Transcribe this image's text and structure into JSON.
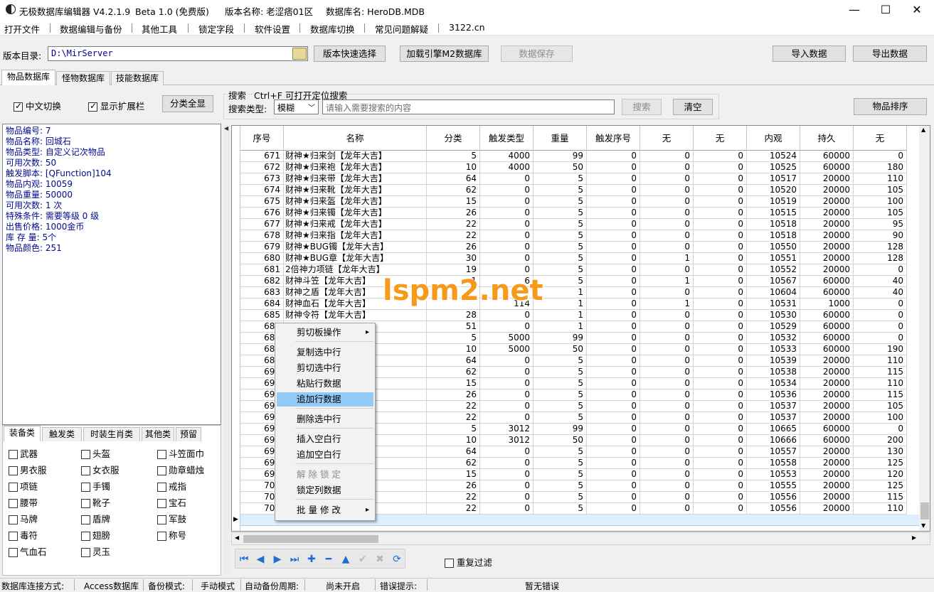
{
  "title": {
    "app": "无极数据库编辑器 V4.2.1.9",
    "beta": "Beta 1.0 (免费版)",
    "version_name": "版本名称: 老涩痞01区",
    "db_name": "数据库名: HeroDB.MDB"
  },
  "window_controls": {
    "minimize": "—",
    "maximize": "☐",
    "close": "✕"
  },
  "menu": [
    "打开文件",
    "数据编辑与备份",
    "其他工具",
    "锁定字段",
    "软件设置",
    "数据库切换",
    "常见问题解疑",
    "3122.cn"
  ],
  "toolbar": {
    "dir_label": "版本目录:",
    "dir_value": "D:\\MirServer",
    "quick_select": "版本快速选择",
    "load_engine": "加载引擎M2数据库",
    "save_data": "数据保存",
    "import": "导入数据",
    "export": "导出数据"
  },
  "tabs": [
    "物品数据库",
    "怪物数据库",
    "技能数据库"
  ],
  "options": {
    "chinese": "中文切换",
    "show_ext": "显示扩展栏",
    "show_all": "分类全显",
    "search_title": "搜索",
    "search_hint": "Ctrl+F 可打开定位搜索",
    "search_type_label": "搜索类型:",
    "search_type_value": "模糊",
    "search_placeholder": "请输入需要搜索的内容",
    "search_btn": "搜索",
    "clear_btn": "清空",
    "sort_btn": "物品排序"
  },
  "info_lines": [
    "物品编号: 7",
    "物品名称: 回城石",
    "物品类型: 自定义记次物品",
    "可用次数: 50",
    "触发脚本: [QFunction]104",
    "物品内观: 10059",
    "物品重量: 50000",
    "可用次数: 1 次",
    "特殊条件: 需要等级 0 级",
    "出售价格: 1000金币",
    "库 存 量: 5个",
    "物品颜色: 251"
  ],
  "cat_tabs": [
    "装备类",
    "触发类",
    "时装生肖类",
    "其他类",
    "预留"
  ],
  "categories": [
    [
      "武器",
      "头盔",
      "斗笠面巾"
    ],
    [
      "男衣服",
      "女衣服",
      "勋章蜡烛"
    ],
    [
      "项链",
      "手镯",
      "戒指"
    ],
    [
      "腰带",
      "靴子",
      "宝石"
    ],
    [
      "马牌",
      "盾牌",
      "军鼓"
    ],
    [
      "毒符",
      "翅膀",
      "称号"
    ],
    [
      "气血石",
      "灵玉",
      ""
    ]
  ],
  "columns": [
    "序号",
    "名称",
    "分类",
    "触发类型",
    "重量",
    "触发序号",
    "无",
    "无",
    "内观",
    "持久",
    "无"
  ],
  "rows": [
    [
      "671",
      "财神★归来剑【龙年大吉】",
      "5",
      "4000",
      "99",
      "0",
      "0",
      "0",
      "10524",
      "60000",
      "0"
    ],
    [
      "672",
      "财神★归来袍【龙年大吉】",
      "10",
      "4000",
      "50",
      "0",
      "0",
      "0",
      "10525",
      "60000",
      "180"
    ],
    [
      "673",
      "财神★归来带【龙年大吉】",
      "64",
      "0",
      "5",
      "0",
      "0",
      "0",
      "10517",
      "20000",
      "110"
    ],
    [
      "674",
      "财神★归来靴【龙年大吉】",
      "62",
      "0",
      "5",
      "0",
      "0",
      "0",
      "10520",
      "20000",
      "105"
    ],
    [
      "675",
      "财神★归来盔【龙年大吉】",
      "15",
      "0",
      "5",
      "0",
      "0",
      "0",
      "10519",
      "20000",
      "100"
    ],
    [
      "676",
      "财神★归来镯【龙年大吉】",
      "26",
      "0",
      "5",
      "0",
      "0",
      "0",
      "10515",
      "20000",
      "105"
    ],
    [
      "677",
      "财神★归来戒【龙年大吉】",
      "22",
      "0",
      "5",
      "0",
      "0",
      "0",
      "10518",
      "20000",
      "95"
    ],
    [
      "678",
      "财神★归来指【龙年大吉】",
      "22",
      "0",
      "5",
      "0",
      "0",
      "0",
      "10518",
      "20000",
      "90"
    ],
    [
      "679",
      "财神★BUG镯【龙年大吉】",
      "26",
      "0",
      "5",
      "0",
      "0",
      "0",
      "10550",
      "20000",
      "128"
    ],
    [
      "680",
      "财神★BUG章【龙年大吉】",
      "30",
      "0",
      "5",
      "0",
      "1",
      "0",
      "10551",
      "20000",
      "128"
    ],
    [
      "681",
      "2倍神力项链【龙年大吉】",
      "19",
      "0",
      "5",
      "0",
      "0",
      "0",
      "10552",
      "20000",
      "0"
    ],
    [
      "682",
      "财神斗笠【龙年大吉】",
      "1",
      "6",
      "5",
      "0",
      "1",
      "0",
      "10567",
      "60000",
      "40"
    ],
    [
      "683",
      "财神之盾【龙年大吉】",
      "",
      "",
      "1",
      "0",
      "0",
      "0",
      "10604",
      "60000",
      "40"
    ],
    [
      "684",
      "财神血石【龙年大吉】",
      "",
      "114",
      "1",
      "0",
      "1",
      "0",
      "10531",
      "1000",
      "0"
    ],
    [
      "685",
      "财神令符【龙年大吉】",
      "28",
      "0",
      "1",
      "0",
      "0",
      "0",
      "10530",
      "60000",
      "0"
    ],
    [
      "686",
      "",
      "51",
      "0",
      "1",
      "0",
      "0",
      "0",
      "10529",
      "60000",
      "0"
    ],
    [
      "687",
      "神】",
      "5",
      "5000",
      "99",
      "0",
      "0",
      "0",
      "10532",
      "60000",
      "0"
    ],
    [
      "688",
      "神】",
      "10",
      "5000",
      "50",
      "0",
      "0",
      "0",
      "10533",
      "60000",
      "190"
    ],
    [
      "689",
      "神】",
      "64",
      "0",
      "5",
      "0",
      "0",
      "0",
      "10539",
      "20000",
      "110"
    ],
    [
      "690",
      "神】",
      "62",
      "0",
      "5",
      "0",
      "0",
      "0",
      "10538",
      "20000",
      "115"
    ],
    [
      "691",
      "神】",
      "15",
      "0",
      "5",
      "0",
      "0",
      "0",
      "10534",
      "20000",
      "110"
    ],
    [
      "692",
      "神】",
      "26",
      "0",
      "5",
      "0",
      "0",
      "0",
      "10536",
      "20000",
      "115"
    ],
    [
      "693",
      "神】",
      "22",
      "0",
      "5",
      "0",
      "0",
      "0",
      "10537",
      "20000",
      "105"
    ],
    [
      "694",
      "神】",
      "22",
      "0",
      "5",
      "0",
      "0",
      "0",
      "10537",
      "20000",
      "100"
    ],
    [
      "695",
      "戚】",
      "5",
      "3012",
      "99",
      "0",
      "0",
      "0",
      "10665",
      "60000",
      "0"
    ],
    [
      "696",
      "戚】",
      "10",
      "3012",
      "50",
      "0",
      "0",
      "0",
      "10666",
      "60000",
      "200"
    ],
    [
      "697",
      "戚】",
      "64",
      "0",
      "5",
      "0",
      "0",
      "0",
      "10557",
      "20000",
      "130"
    ],
    [
      "698",
      "戚】",
      "62",
      "0",
      "5",
      "0",
      "0",
      "0",
      "10558",
      "20000",
      "125"
    ],
    [
      "699",
      "戚】",
      "15",
      "0",
      "5",
      "0",
      "0",
      "0",
      "10553",
      "20000",
      "120"
    ],
    [
      "700",
      "戚】",
      "26",
      "0",
      "5",
      "0",
      "0",
      "0",
      "10555",
      "20000",
      "125"
    ],
    [
      "701",
      "戚】",
      "22",
      "0",
      "5",
      "0",
      "0",
      "0",
      "10556",
      "20000",
      "115"
    ],
    [
      "702",
      "戚】",
      "22",
      "0",
      "5",
      "0",
      "0",
      "0",
      "10556",
      "20000",
      "110"
    ]
  ],
  "context_menu": [
    {
      "label": "剪切板操作",
      "sub": true
    },
    {
      "label": "复制选中行"
    },
    {
      "label": "剪切选中行"
    },
    {
      "label": "粘贴行数据"
    },
    {
      "label": "追加行数据",
      "highlight": true
    },
    {
      "label": "删除选中行"
    },
    {
      "label": "插入空白行"
    },
    {
      "label": "追加空白行"
    },
    {
      "label": "解 除 锁 定",
      "disabled": true
    },
    {
      "label": "锁定列数据"
    },
    {
      "label": "批 量 修 改",
      "sub": true
    }
  ],
  "nav": {
    "repeat_filter": "重复过滤"
  },
  "watermark": "lspm2.net",
  "status": {
    "conn_label": "数据库连接方式:",
    "conn_value": "Access数据库",
    "backup_label": "备份模式:",
    "backup_value": "手动模式",
    "auto_label": "自动备份周期:",
    "auto_value": "尚未开启",
    "err_label": "错误提示:",
    "err_value": "暂无错误"
  }
}
